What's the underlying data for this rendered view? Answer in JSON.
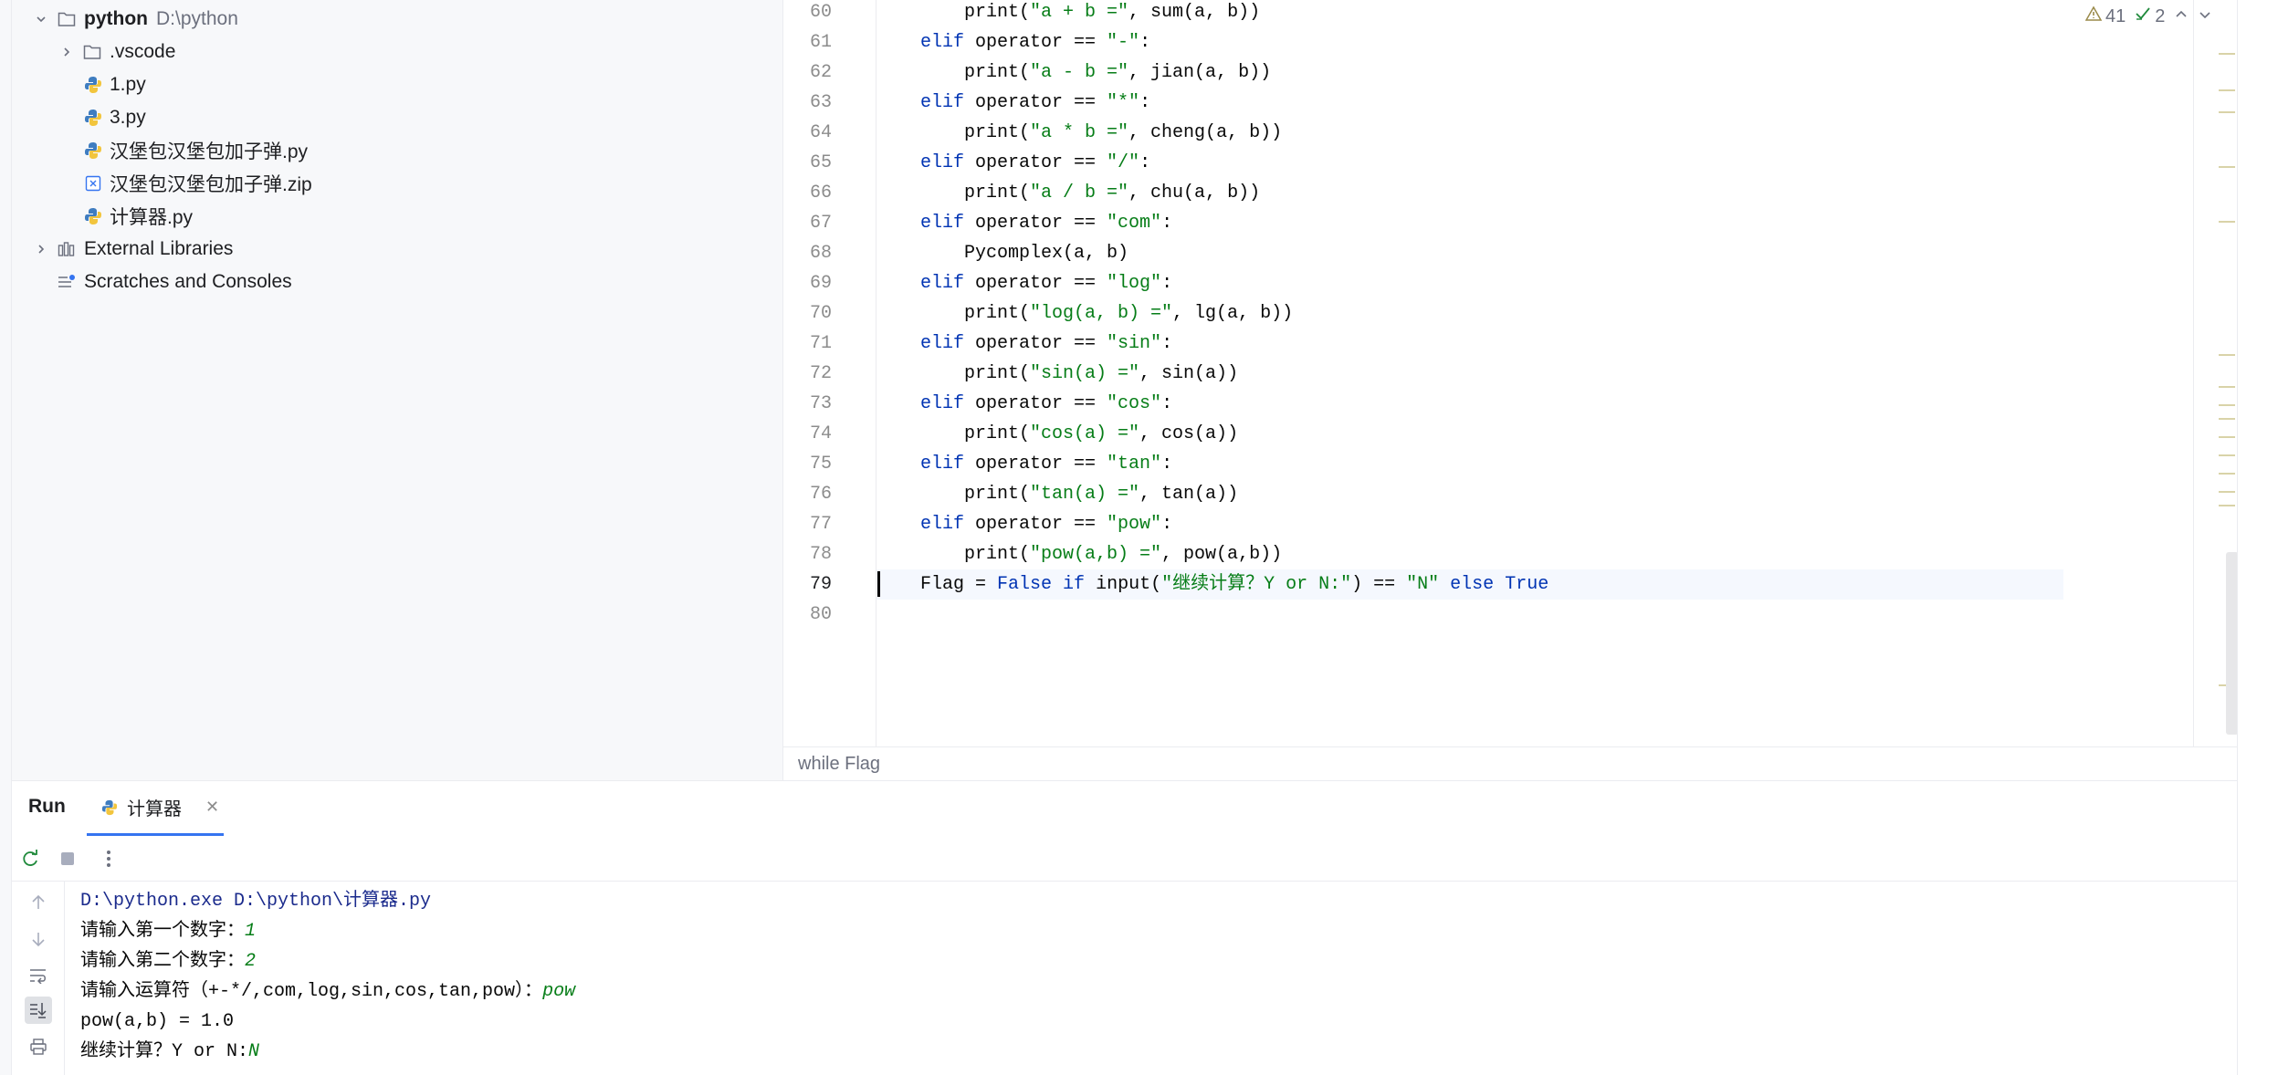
{
  "project": {
    "root_name": "python",
    "root_path": "D:\\python",
    "items": [
      {
        "label": ".vscode",
        "kind": "folder"
      },
      {
        "label": "1.py",
        "kind": "python"
      },
      {
        "label": "3.py",
        "kind": "python"
      },
      {
        "label": "汉堡包汉堡包加子弹.py",
        "kind": "python"
      },
      {
        "label": "汉堡包汉堡包加子弹.zip",
        "kind": "zip"
      },
      {
        "label": "计算器.py",
        "kind": "python"
      }
    ],
    "external_libraries": "External Libraries",
    "scratches": "Scratches and Consoles"
  },
  "editor": {
    "line_numbers": [
      "60",
      "61",
      "62",
      "63",
      "64",
      "65",
      "66",
      "67",
      "68",
      "69",
      "70",
      "71",
      "72",
      "73",
      "74",
      "75",
      "76",
      "77",
      "78",
      "79",
      "80"
    ],
    "current_line": "79",
    "inspections": {
      "warnings": "41",
      "typos": "2"
    },
    "breadcrumb": "while Flag",
    "code": {
      "l60": {
        "kw": "",
        "pre": "print(",
        "str": "\"a + b =\"",
        "post": ", sum(a, b))"
      },
      "l61": {
        "kw": "elif",
        "pre": " operator == ",
        "str": "\"-\"",
        "post": ":"
      },
      "l62": {
        "kw": "",
        "pre": "print(",
        "str": "\"a - b =\"",
        "post": ", jian(a, b))"
      },
      "l63": {
        "kw": "elif",
        "pre": " operator == ",
        "str": "\"*\"",
        "post": ":"
      },
      "l64": {
        "kw": "",
        "pre": "print(",
        "str": "\"a * b =\"",
        "post": ", cheng(a, b))"
      },
      "l65": {
        "kw": "elif",
        "pre": " operator == ",
        "str": "\"/\"",
        "post": ":"
      },
      "l66": {
        "kw": "",
        "pre": "print(",
        "str": "\"a / b =\"",
        "post": ", chu(a, b))"
      },
      "l67": {
        "kw": "elif",
        "pre": " operator == ",
        "str": "\"com\"",
        "post": ":"
      },
      "l68": {
        "kw": "",
        "pre": "Pycomplex(a, b)",
        "str": "",
        "post": ""
      },
      "l69": {
        "kw": "elif",
        "pre": " operator == ",
        "str": "\"log\"",
        "post": ":"
      },
      "l70": {
        "kw": "",
        "pre": "print(",
        "str": "\"log(a, b) =\"",
        "post": ", lg(a, b))"
      },
      "l71": {
        "kw": "elif",
        "pre": " operator == ",
        "str": "\"sin\"",
        "post": ":"
      },
      "l72": {
        "kw": "",
        "pre": "print(",
        "str": "\"sin(a) =\"",
        "post": ", sin(a))"
      },
      "l73": {
        "kw": "elif",
        "pre": " operator == ",
        "str": "\"cos\"",
        "post": ":"
      },
      "l74": {
        "kw": "",
        "pre": "print(",
        "str": "\"cos(a) =\"",
        "post": ", cos(a))"
      },
      "l75": {
        "kw": "elif",
        "pre": " operator == ",
        "str": "\"tan\"",
        "post": ":"
      },
      "l76": {
        "kw": "",
        "pre": "print(",
        "str": "\"tan(a) =\"",
        "post": ", tan(a))"
      },
      "l77": {
        "kw": "elif",
        "pre": " operator == ",
        "str": "\"pow\"",
        "post": ":"
      },
      "l78": {
        "kw": "",
        "pre": "print(",
        "str": "\"pow(a,b) =\"",
        "post": ", pow(a,b))"
      },
      "l79": {
        "a": "Flag = ",
        "b": "False",
        "c": " ",
        "d": "if",
        "e": " input(",
        "f": "\"继续计算？Y or N:\"",
        "g": ") == ",
        "h": "\"N\"",
        "i": " ",
        "j": "else",
        "k": " ",
        "l": "True"
      },
      "l80": ""
    }
  },
  "run": {
    "title": "Run",
    "tab_label": "计算器",
    "console": {
      "cmd": "D:\\python.exe D:\\python\\计算器.py",
      "prompt1": "请输入第一个数字：",
      "input1": "1",
      "prompt2": "请输入第二个数字：",
      "input2": "2",
      "prompt3": "请输入运算符（+-*/,com,log,sin,cos,tan,pow）：",
      "input3": "pow",
      "result": "pow(a,b) = 1.0",
      "prompt4": "继续计算？Y or N:",
      "input4": "N"
    }
  },
  "colors": {
    "keyword": "#0033b3",
    "string": "#067d17",
    "accent": "#3574f0"
  }
}
